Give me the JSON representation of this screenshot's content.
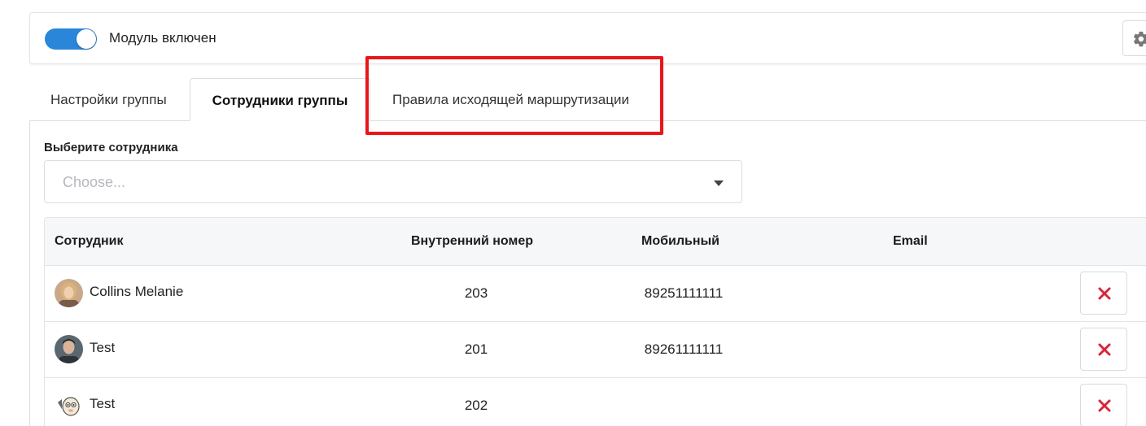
{
  "module": {
    "toggle_on": true,
    "label": "Модуль включен"
  },
  "tabs": [
    {
      "label": "Настройки группы",
      "active": false
    },
    {
      "label": "Сотрудники группы",
      "active": true
    },
    {
      "label": "Правила исходящей маршрутизации",
      "active": false
    }
  ],
  "select": {
    "label": "Выберите сотрудника",
    "placeholder": "Choose..."
  },
  "table": {
    "headers": [
      "Сотрудник",
      "Внутренний номер",
      "Мобильный",
      "Email"
    ],
    "rows": [
      {
        "name": "Collins Melanie",
        "ext": "203",
        "mobile": "89251111111",
        "email": "",
        "avatar": "woman-photo"
      },
      {
        "name": "Test",
        "ext": "201",
        "mobile": "89261111111",
        "email": "",
        "avatar": "man-photo"
      },
      {
        "name": "Test",
        "ext": "202",
        "mobile": "",
        "email": "",
        "avatar": "cartoon-animal"
      }
    ]
  },
  "colors": {
    "accent": "#2a86d8",
    "delete": "#d7263d",
    "highlight": "#e8161b"
  },
  "icons": {
    "settings": "gear-icon",
    "delete": "close-icon",
    "dropdown": "caret-down-icon"
  }
}
